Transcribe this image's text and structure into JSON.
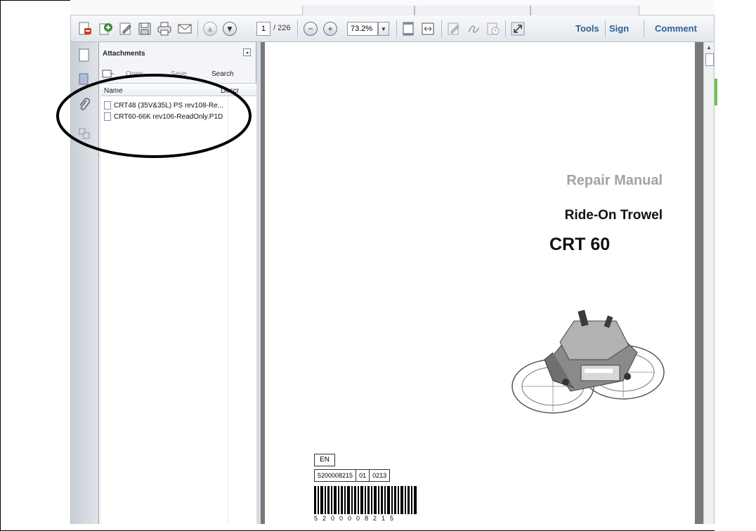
{
  "toolbar": {
    "page_current": "1",
    "page_total": "/ 226",
    "zoom": "73.2%",
    "tools_label": "Tools",
    "sign_label": "Sign",
    "comment_label": "Comment"
  },
  "attachments_panel": {
    "title": "Attachments",
    "open_label": "Open",
    "save_label": "Save",
    "search_label": "Search",
    "col_name": "Name",
    "col_description": "Descr",
    "files": [
      "CRT48 (35V&35L) PS rev108-Re...",
      "CRT60-66K rev106-ReadOnly.P1D"
    ]
  },
  "document": {
    "title": "Repair Manual",
    "subtitle": "Ride-On Trowel",
    "model": "CRT 60",
    "language": "EN",
    "codes": [
      "5200008215",
      "01",
      "0213"
    ],
    "barcode_number": "5200008215"
  },
  "colors": {
    "accent_link": "#2e5f96",
    "doc_bg": "#787878"
  }
}
